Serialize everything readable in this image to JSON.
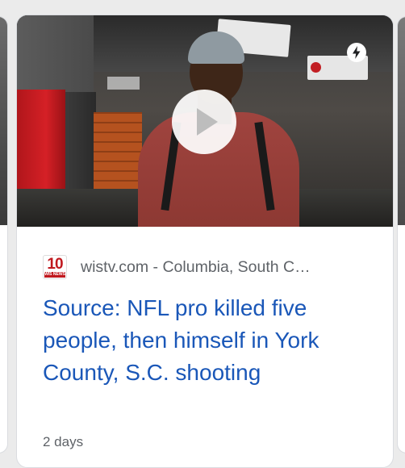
{
  "card": {
    "source_logo": {
      "number": "10",
      "sub": "WIS NEWS"
    },
    "source": "wistv.com - Columbia, South C…",
    "headline": "Source: NFL pro killed five people, then himself in York County, S.C. shooting",
    "footer_partial": "2 days"
  },
  "colors": {
    "headline": "#1a57b8",
    "source_text": "#5f6368",
    "logo_red": "#c0181e"
  },
  "icons": {
    "play": "play-icon",
    "amp": "lightning-bolt-icon"
  }
}
